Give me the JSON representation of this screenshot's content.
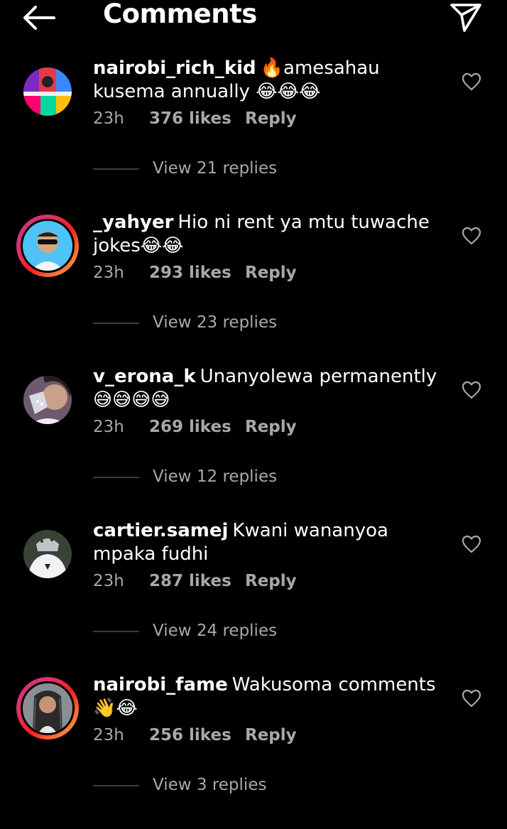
{
  "header": {
    "title": "Comments",
    "back_icon": "arrow-left-icon",
    "send_icon": "paper-plane-icon"
  },
  "comments": [
    {
      "username": "nairobi_rich_kid",
      "text": "🔥amesahau kusema annually 😂😂😂",
      "time": "23h",
      "likes": "376 likes",
      "reply_label": "Reply",
      "view_replies": "View 21 replies",
      "story_ring": false
    },
    {
      "username": "_yahyer",
      "text": "Hio ni rent ya mtu tuwache jokes😂😂",
      "time": "23h",
      "likes": "293 likes",
      "reply_label": "Reply",
      "view_replies": "View 23 replies",
      "story_ring": true
    },
    {
      "username": "v_erona_k",
      "text": "Unanyolewa permanently 😅😅😅😅",
      "time": "23h",
      "likes": "269 likes",
      "reply_label": "Reply",
      "view_replies": "View 12 replies",
      "story_ring": false
    },
    {
      "username": "cartier.samej",
      "text": "Kwani wananyoa mpaka fudhi",
      "time": "23h",
      "likes": "287 likes",
      "reply_label": "Reply",
      "view_replies": "View 24 replies",
      "story_ring": false
    },
    {
      "username": "nairobi_fame",
      "text": "Wakusoma comments 👋😂",
      "time": "23h",
      "likes": "256 likes",
      "reply_label": "Reply",
      "view_replies": "View 3 replies",
      "story_ring": true
    }
  ],
  "colors": {
    "background": "#000000",
    "text": "#ffffff",
    "secondary_text": "#a8a8a8",
    "divider": "#3d3d3d"
  }
}
